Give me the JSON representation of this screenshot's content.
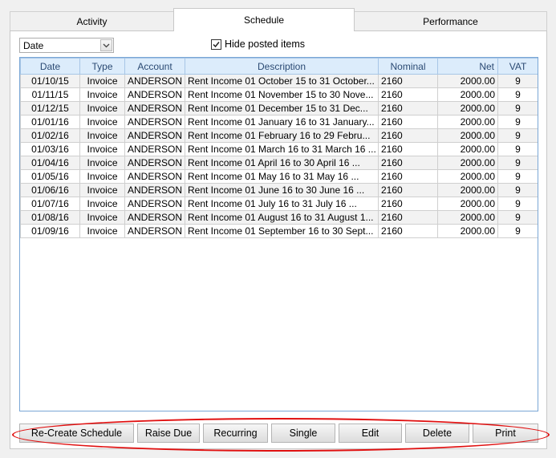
{
  "tabs": [
    {
      "label": "Activity"
    },
    {
      "label": "Schedule"
    },
    {
      "label": "Performance"
    }
  ],
  "filter": {
    "selected": "Date"
  },
  "hide_posted": {
    "label": "Hide posted items",
    "checked": true
  },
  "grid": {
    "columns": [
      "Date",
      "Type",
      "Account",
      "Description",
      "Nominal",
      "Net",
      "VAT"
    ],
    "rows": [
      {
        "date": "01/10/15",
        "type": "Invoice",
        "account": "ANDERSON",
        "description": "Rent Income 01 October 15 to 31 October...",
        "nominal": "2160",
        "net": "2000.00",
        "vat": "9"
      },
      {
        "date": "01/11/15",
        "type": "Invoice",
        "account": "ANDERSON",
        "description": "Rent Income 01 November 15 to 30 Nove...",
        "nominal": "2160",
        "net": "2000.00",
        "vat": "9"
      },
      {
        "date": "01/12/15",
        "type": "Invoice",
        "account": "ANDERSON",
        "description": "Rent Income 01 December 15 to 31 Dec...",
        "nominal": "2160",
        "net": "2000.00",
        "vat": "9"
      },
      {
        "date": "01/01/16",
        "type": "Invoice",
        "account": "ANDERSON",
        "description": "Rent Income 01 January 16 to 31 January...",
        "nominal": "2160",
        "net": "2000.00",
        "vat": "9"
      },
      {
        "date": "01/02/16",
        "type": "Invoice",
        "account": "ANDERSON",
        "description": "Rent Income 01 February 16 to 29 Febru...",
        "nominal": "2160",
        "net": "2000.00",
        "vat": "9"
      },
      {
        "date": "01/03/16",
        "type": "Invoice",
        "account": "ANDERSON",
        "description": "Rent Income 01 March 16 to 31 March 16 ...",
        "nominal": "2160",
        "net": "2000.00",
        "vat": "9"
      },
      {
        "date": "01/04/16",
        "type": "Invoice",
        "account": "ANDERSON",
        "description": "Rent Income 01 April 16 to 30 April 16      ...",
        "nominal": "2160",
        "net": "2000.00",
        "vat": "9"
      },
      {
        "date": "01/05/16",
        "type": "Invoice",
        "account": "ANDERSON",
        "description": "Rent Income 01 May 16 to 31 May 16         ...",
        "nominal": "2160",
        "net": "2000.00",
        "vat": "9"
      },
      {
        "date": "01/06/16",
        "type": "Invoice",
        "account": "ANDERSON",
        "description": "Rent Income 01 June 16 to 30 June 16      ...",
        "nominal": "2160",
        "net": "2000.00",
        "vat": "9"
      },
      {
        "date": "01/07/16",
        "type": "Invoice",
        "account": "ANDERSON",
        "description": "Rent Income 01 July 16 to 31 July 16         ...",
        "nominal": "2160",
        "net": "2000.00",
        "vat": "9"
      },
      {
        "date": "01/08/16",
        "type": "Invoice",
        "account": "ANDERSON",
        "description": "Rent Income 01 August 16 to 31 August 1...",
        "nominal": "2160",
        "net": "2000.00",
        "vat": "9"
      },
      {
        "date": "01/09/16",
        "type": "Invoice",
        "account": "ANDERSON",
        "description": "Rent Income 01 September 16 to 30 Sept...",
        "nominal": "2160",
        "net": "2000.00",
        "vat": "9"
      }
    ]
  },
  "buttons": {
    "recreate": "Re-Create Schedule",
    "raise_due": "Raise Due",
    "recurring": "Recurring",
    "single": "Single",
    "edit": "Edit",
    "delete": "Delete",
    "print": "Print"
  },
  "colors": {
    "highlight": "#e01010",
    "grid_header": "#dcecfb",
    "grid_border": "#7aa7d6"
  }
}
